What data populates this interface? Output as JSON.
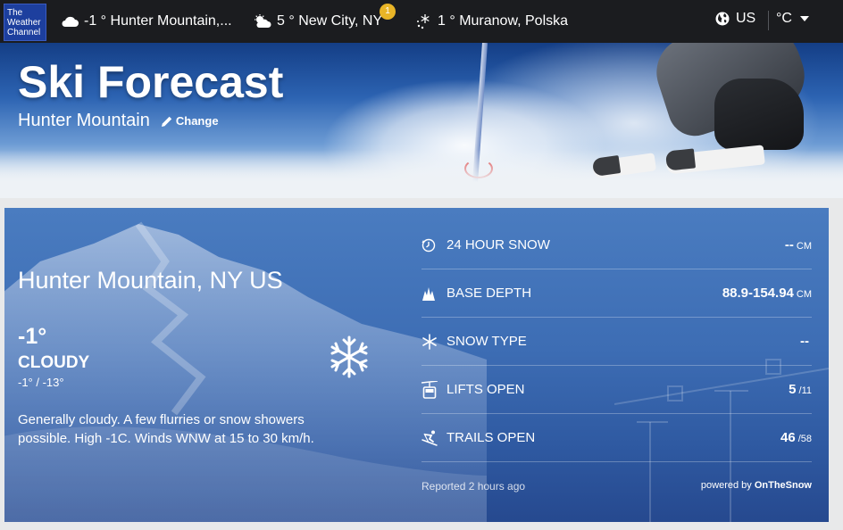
{
  "header": {
    "logo_lines": [
      "The",
      "Weather",
      "Channel"
    ],
    "locations": [
      {
        "icon": "cloud-icon",
        "text": "-1 ° Hunter Mountain,..."
      },
      {
        "icon": "partly-cloudy-icon",
        "text": "5 ° New City, NY",
        "badge": "1"
      },
      {
        "icon": "snow-icon",
        "text": "1 ° Muranow, Polska"
      }
    ],
    "region": "US",
    "unit": "°C"
  },
  "hero": {
    "title": "Ski Forecast",
    "resort": "Hunter Mountain",
    "change_label": "Change"
  },
  "conditions": {
    "location": "Hunter Mountain, NY US",
    "temperature": "-1°",
    "condition": "CLOUDY",
    "hi_lo": "-1° / -13°",
    "icon": "snowflake-icon",
    "description": "Generally cloudy. A few flurries or snow showers possible. High -1C. Winds WNW at 15 to 30 km/h."
  },
  "stats": [
    {
      "icon": "clock-icon",
      "label": "24 HOUR SNOW",
      "value": "--",
      "unit": "CM"
    },
    {
      "icon": "base-depth-icon",
      "label": "BASE DEPTH",
      "value": "88.9-154.94",
      "unit": "CM"
    },
    {
      "icon": "snow-type-icon",
      "label": "SNOW TYPE",
      "value": "--",
      "unit": ""
    },
    {
      "icon": "gondola-icon",
      "label": "LIFTS OPEN",
      "value": "5",
      "unit": "/11"
    },
    {
      "icon": "skier-icon",
      "label": "TRAILS OPEN",
      "value": "46",
      "unit": "/58"
    }
  ],
  "footer": {
    "reported": "Reported 2 hours ago",
    "powered_prefix": "powered by",
    "powered_brand": "OnTheSnow"
  },
  "colors": {
    "topbar": "#1b1c1f",
    "logo_bg": "#1d3f9e",
    "card_blue": "#3d6db4",
    "badge": "#e8b427"
  }
}
